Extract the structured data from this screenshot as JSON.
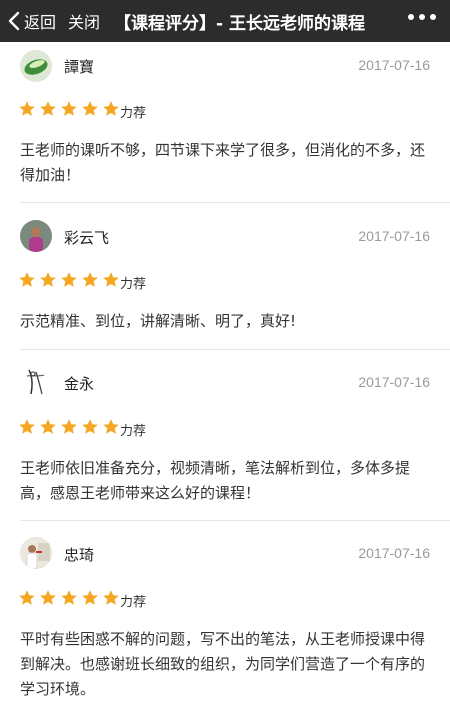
{
  "nav": {
    "back_label": "返回",
    "close_label": "关闭",
    "title": "【课程评分】- 王长远老师的课程"
  },
  "reviews": [
    {
      "username": "譚寶",
      "date": "2017-07-16",
      "rating": 5,
      "rating_label": "力荐",
      "comment": "王老师的课听不够，四节课下来学了很多，但消化的不多，还得加油！",
      "avatar_icon": "green-leaf-avatar"
    },
    {
      "username": "彩云飞",
      "date": "2017-07-16",
      "rating": 5,
      "rating_label": "力荐",
      "comment": "示范精准、到位，讲解清晰、明了，真好!",
      "avatar_icon": "person-photo-avatar"
    },
    {
      "username": "金永",
      "date": "2017-07-16",
      "rating": 5,
      "rating_label": "力荐",
      "comment": "王老师依旧准备充分，视频清晰，笔法解析到位，多体多提高，感恩王老师带来这么好的课程！",
      "avatar_icon": "ink-sketch-avatar"
    },
    {
      "username": "忠琦",
      "date": "2017-07-16",
      "rating": 5,
      "rating_label": "力荐",
      "comment": "平时有些困惑不解的问题，写不出的笔法，从王老师授课中得到解决。也感谢班长细致的组织，为同学们营造了一个有序的学习环境。",
      "avatar_icon": "lecture-photo-avatar"
    }
  ],
  "colors": {
    "navbar_bg": "#2c2c2c",
    "star": "#f5a623",
    "date": "#9a9a9a",
    "divider": "#e6e6e6"
  }
}
